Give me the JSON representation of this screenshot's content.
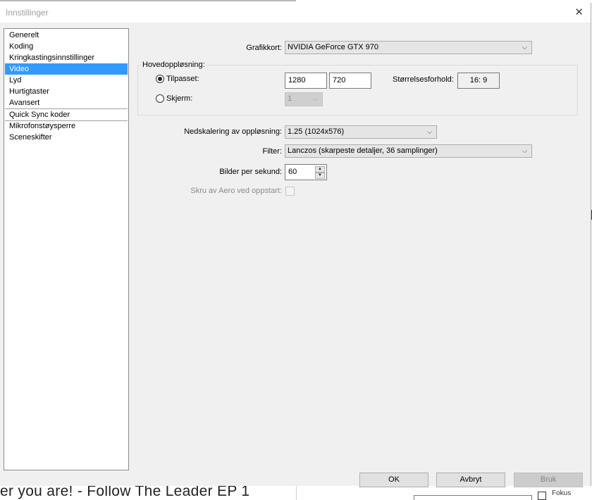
{
  "window": {
    "title": "Innstillinger",
    "close_glyph": "✕"
  },
  "nav": {
    "items": [
      {
        "label": "Generelt",
        "selected": false
      },
      {
        "label": "Koding",
        "selected": false
      },
      {
        "label": "Kringkastingsinnstillinger",
        "selected": false
      },
      {
        "label": "Video",
        "selected": true
      },
      {
        "label": "Lyd",
        "selected": false
      },
      {
        "label": "Hurtigtaster",
        "selected": false
      },
      {
        "label": "Avansert",
        "selected": false
      },
      {
        "label": "Quick Sync koder",
        "selected": false
      },
      {
        "label": "Mikrofonstøysperre",
        "selected": false
      },
      {
        "label": "Sceneskifter",
        "selected": false
      }
    ]
  },
  "video": {
    "graphics_card": {
      "label": "Grafikkort:",
      "value": "NVIDIA GeForce GTX 970"
    },
    "base_resolution": {
      "group_label": "Hovedoppløsning:",
      "custom": {
        "label": "Tilpasset:",
        "checked": true,
        "width": "1280",
        "height": "720"
      },
      "aspect": {
        "label": "Størrelsesforhold:",
        "value": "16: 9"
      },
      "monitor": {
        "label": "Skjerm:",
        "checked": false,
        "value": "1",
        "enabled": false
      }
    },
    "downscale": {
      "label": "Nedskalering av oppløsning:",
      "value": "1.25  (1024x576)"
    },
    "filter": {
      "label": "Filter:",
      "value": "Lanczos (skarpeste detaljer, 36 samplinger)"
    },
    "fps": {
      "label": "Bilder per sekund:",
      "value": "60"
    },
    "aero": {
      "label": "Skru av Aero ved oppstart:",
      "checked": false,
      "enabled": false
    }
  },
  "buttons": {
    "ok": "OK",
    "cancel": "Avbryt",
    "apply": "Bruk"
  },
  "background": {
    "text": "er you are! - Follow The Leader EP 1",
    "checkbox_label": "Fokus"
  },
  "icons": {
    "dropdown": "chevron-down-icon",
    "spin_up": "arrow-up-icon",
    "spin_down": "arrow-down-icon",
    "close": "close-icon"
  }
}
